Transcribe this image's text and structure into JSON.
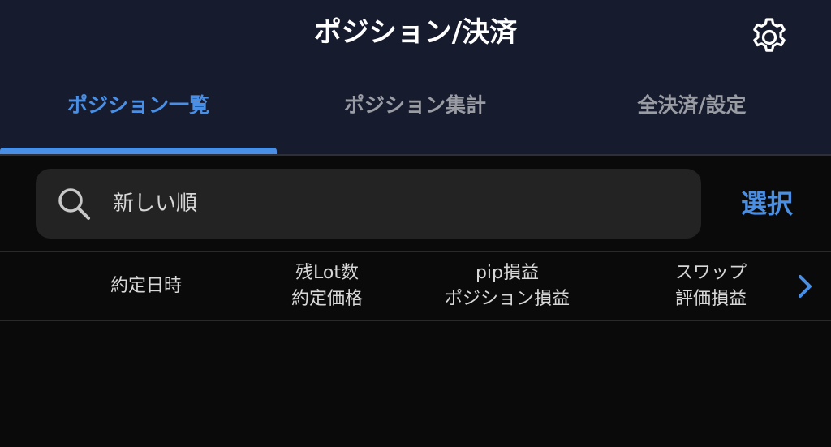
{
  "header": {
    "title": "ポジション/決済",
    "settings_icon": "gear-icon"
  },
  "tabs": [
    {
      "label": "ポジション一覧",
      "active": true
    },
    {
      "label": "ポジション集計",
      "active": false
    },
    {
      "label": "全決済/設定",
      "active": false
    }
  ],
  "search": {
    "icon": "search-icon",
    "sort_label": "新しい順"
  },
  "select_button": "選択",
  "columns": [
    {
      "line1": "約定日時",
      "line2": ""
    },
    {
      "line1": "残Lot数",
      "line2": "約定価格"
    },
    {
      "line1": "pip損益",
      "line2": "ポジション損益"
    },
    {
      "line1": "スワップ",
      "line2": "評価損益"
    }
  ],
  "next_columns_icon": "chevron-right-icon",
  "colors": {
    "accent": "#4a8fe6",
    "header_bg": "#161b2e",
    "body_bg": "#0a0a0a",
    "search_bg": "#232323"
  }
}
